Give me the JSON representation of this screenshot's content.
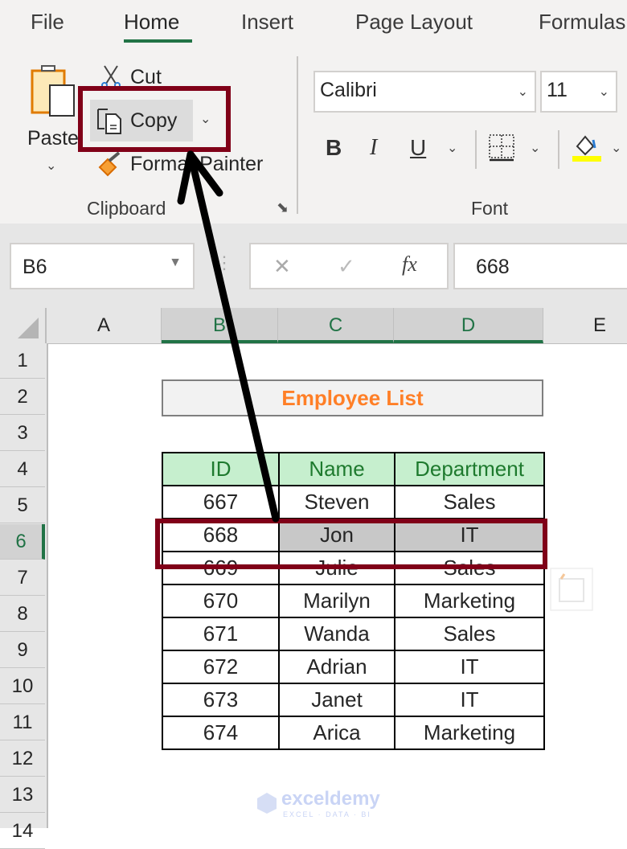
{
  "ribbon": {
    "tabs": [
      {
        "label": "File",
        "active": false
      },
      {
        "label": "Home",
        "active": true
      },
      {
        "label": "Insert",
        "active": false
      },
      {
        "label": "Page Layout",
        "active": false
      },
      {
        "label": "Formulas",
        "active": false
      }
    ],
    "clipboard": {
      "paste_label": "Paste",
      "cut_label": "Cut",
      "copy_label": "Copy",
      "format_painter_label": "Format Painter",
      "group_label": "Clipboard"
    },
    "font": {
      "font_name": "Calibri",
      "font_size": "11",
      "bold_label": "B",
      "italic_label": "I",
      "underline_label": "U",
      "group_label": "Font",
      "fill_color": "#ffff00"
    }
  },
  "formula_bar": {
    "name_box": "B6",
    "fx_label": "fx",
    "cancel_icon": "✕",
    "enter_icon": "✓",
    "value": "668"
  },
  "grid": {
    "columns": [
      "A",
      "B",
      "C",
      "D",
      "E"
    ],
    "selected_columns": [
      "B",
      "C",
      "D"
    ],
    "rows": [
      "1",
      "2",
      "3",
      "4",
      "5",
      "6",
      "7",
      "8",
      "9",
      "10",
      "11",
      "12",
      "13",
      "14"
    ],
    "selected_row": "6",
    "title": "Employee List",
    "headers": [
      "ID",
      "Name",
      "Department"
    ],
    "records": [
      [
        "667",
        "Steven",
        "Sales"
      ],
      [
        "668",
        "Jon",
        "IT"
      ],
      [
        "669",
        "Julie",
        "Sales"
      ],
      [
        "670",
        "Marilyn",
        "Marketing"
      ],
      [
        "671",
        "Wanda",
        "Sales"
      ],
      [
        "672",
        "Adrian",
        "IT"
      ],
      [
        "673",
        "Janet",
        "IT"
      ],
      [
        "674",
        "Arica",
        "Marketing"
      ]
    ]
  },
  "annotations": {
    "highlight_color": "#800018",
    "arrow_color": "#000000"
  },
  "watermark": {
    "name": "exceldemy",
    "tagline": "EXCEL · DATA · BI"
  }
}
